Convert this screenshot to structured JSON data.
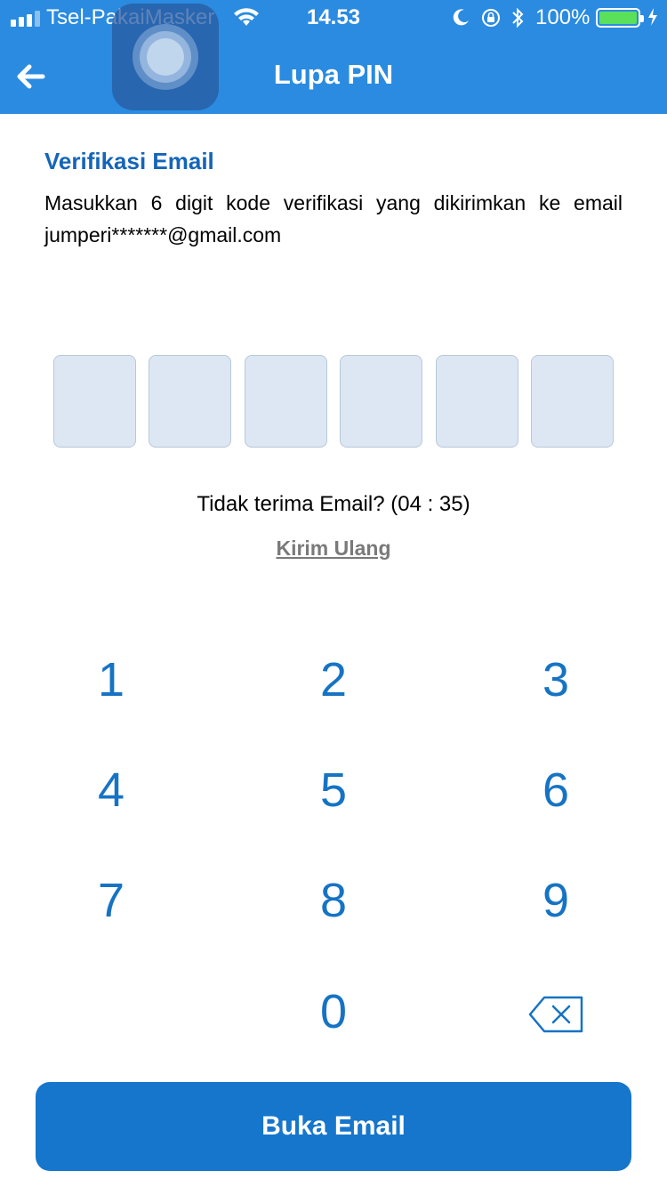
{
  "status_bar": {
    "carrier": "Tsel-PakaiMasker",
    "time": "14.53",
    "battery_pct": "100%",
    "battery_level": 1.0
  },
  "header": {
    "title": "Lupa PIN"
  },
  "content": {
    "heading": "Verifikasi Email",
    "description": "Masukkan 6 digit kode verifikasi yang dikirimkan ke email jumperi*******@gmail.com",
    "code_length": 6,
    "no_email_text": "Tidak terima Email? (04 : 35)",
    "resend_label": "Kirim Ulang"
  },
  "keypad": {
    "keys": [
      "1",
      "2",
      "3",
      "4",
      "5",
      "6",
      "7",
      "8",
      "9",
      "",
      "0",
      "backspace-icon"
    ]
  },
  "cta": {
    "label": "Buka Email"
  },
  "colors": {
    "header_bg": "#2a8be0",
    "heading": "#1565b8",
    "key_text": "#1673c4",
    "button_bg": "#1676cc",
    "code_box_bg": "#dde7f3"
  }
}
